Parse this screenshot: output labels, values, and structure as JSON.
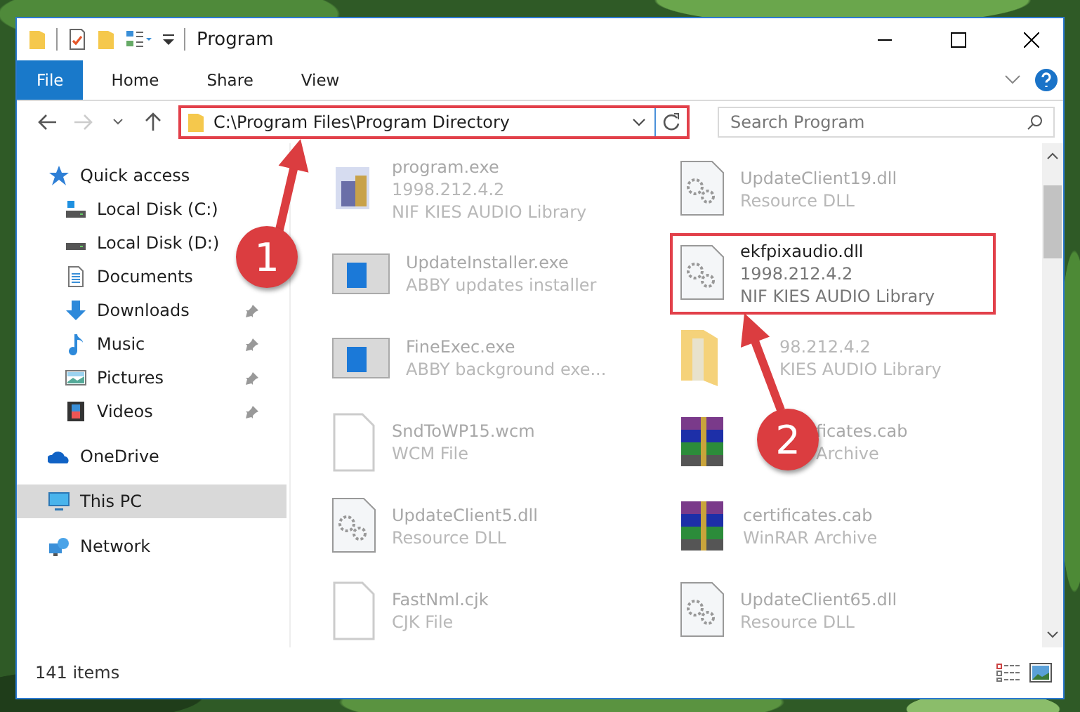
{
  "window": {
    "title": "Program"
  },
  "ribbon": {
    "tabs": [
      {
        "label": "File",
        "selected": true
      },
      {
        "label": "Home",
        "selected": false
      },
      {
        "label": "Share",
        "selected": false
      },
      {
        "label": "View",
        "selected": false
      }
    ]
  },
  "address_bar": {
    "path": "C:\\Program Files\\Program Directory",
    "highlighted": true
  },
  "search": {
    "placeholder": "Search Program"
  },
  "sidebar": {
    "groups": [
      {
        "label": "Quick access",
        "kind": "star",
        "selected": false,
        "children": [
          {
            "label": "Local Disk (C:)",
            "kind": "drive-c",
            "pinned": false,
            "selected": false
          },
          {
            "label": "Local Disk (D:)",
            "kind": "drive",
            "pinned": false,
            "selected": false
          },
          {
            "label": "Documents",
            "kind": "documents",
            "pinned": false,
            "selected": false
          },
          {
            "label": "Downloads",
            "kind": "downloads",
            "pinned": true,
            "selected": false
          },
          {
            "label": "Music",
            "kind": "music",
            "pinned": true,
            "selected": false
          },
          {
            "label": "Pictures",
            "kind": "pictures",
            "pinned": true,
            "selected": false
          },
          {
            "label": "Videos",
            "kind": "videos",
            "pinned": true,
            "selected": false
          }
        ]
      },
      {
        "label": "OneDrive",
        "kind": "cloud",
        "selected": false
      },
      {
        "label": "This PC",
        "kind": "pc",
        "selected": true
      },
      {
        "label": "Network",
        "kind": "network",
        "selected": false
      }
    ]
  },
  "files": [
    {
      "name": "program.exe",
      "details": [
        "1998.212.4.2",
        "NIF KIES AUDIO Library"
      ],
      "kind": "program",
      "highlighted": false
    },
    {
      "name": "UpdateClient19.dll",
      "details": [
        "Resource DLL"
      ],
      "kind": "dll",
      "highlighted": false
    },
    {
      "name": "UpdateInstaller.exe",
      "details": [
        "ABBY updates installer"
      ],
      "kind": "window",
      "highlighted": false
    },
    {
      "name": "ekfpixaudio.dll",
      "details": [
        "1998.212.4.2",
        "NIF KIES AUDIO Library"
      ],
      "kind": "dll",
      "highlighted": true
    },
    {
      "name": "FineExec.exe",
      "details": [
        "ABBY background exe..."
      ],
      "kind": "window",
      "highlighted": false
    },
    {
      "details": [
        "98.212.4.2",
        "KIES AUDIO Library"
      ],
      "kind": "folder-covered",
      "highlighted": false
    },
    {
      "name": "SndToWP15.wcm",
      "details": [
        "WCM File"
      ],
      "kind": "blank",
      "highlighted": false
    },
    {
      "name": "ficates.cab",
      "details": [
        "Archive"
      ],
      "kind": "archive-covered",
      "highlighted": false
    },
    {
      "name": "UpdateClient5.dll",
      "details": [
        "Resource DLL"
      ],
      "kind": "dll",
      "highlighted": false
    },
    {
      "name": "certificates.cab",
      "details": [
        "WinRAR Archive"
      ],
      "kind": "archive",
      "highlighted": false
    },
    {
      "name": "FastNml.cjk",
      "details": [
        "CJK File"
      ],
      "kind": "blank",
      "highlighted": false
    },
    {
      "name": "UpdateClient65.dll",
      "details": [
        "Resource DLL"
      ],
      "kind": "dll",
      "highlighted": false
    }
  ],
  "annotations": [
    {
      "label": "1"
    },
    {
      "label": "2"
    }
  ],
  "status_bar": {
    "count": "141 items"
  }
}
